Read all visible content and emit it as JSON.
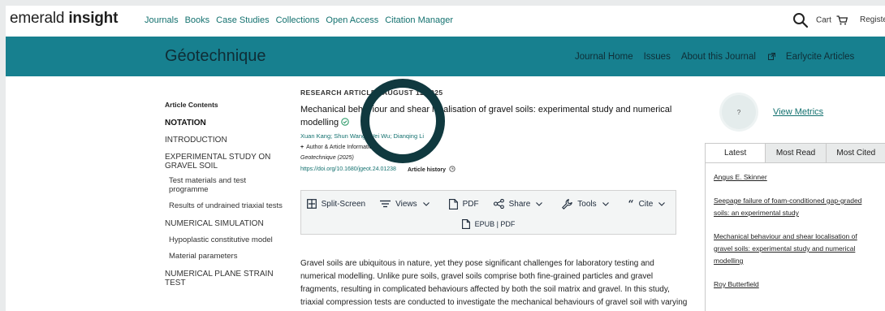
{
  "brand": {
    "logo_light": "emerald",
    "logo_bold": "insight"
  },
  "topnav": [
    "Journals",
    "Books",
    "Case Studies",
    "Collections",
    "Open Access",
    "Citation Manager"
  ],
  "header_right": {
    "cart": "Cart",
    "register": "Registe"
  },
  "journal": {
    "title": "Géotechnique",
    "links": [
      "Journal Home",
      "Issues",
      "About this Journal",
      "Earlycite Articles"
    ]
  },
  "toc": {
    "heading": "Article Contents",
    "items": [
      {
        "label": "NOTATION",
        "level": 1,
        "active": true
      },
      {
        "label": "INTRODUCTION",
        "level": 1
      },
      {
        "label": "EXPERIMENTAL STUDY ON GRAVEL SOIL",
        "level": 1
      },
      {
        "label": "Test materials and test programme",
        "level": 2
      },
      {
        "label": "Results of undrained triaxial tests",
        "level": 2
      },
      {
        "label": "NUMERICAL SIMULATION",
        "level": 1
      },
      {
        "label": "Hypoplastic constitutive model",
        "level": 2
      },
      {
        "label": "Material parameters",
        "level": 2
      },
      {
        "label": "NUMERICAL PLANE STRAIN TEST",
        "level": 1
      }
    ]
  },
  "article": {
    "type_date": "RESEARCH ARTICLE |  AUGUST 12 2025",
    "title": "Mechanical behaviour and shear localisation of gravel soils: experimental study and numerical modelling",
    "authors": "Xuan Kang; Shun Wang; Wei Wu; Dianqing Li",
    "author_info": "Author & Article Information",
    "publication": "Geotechnique (2025)",
    "doi": "https://doi.org/10.1680/jgeot.24.01238",
    "history": "Article history"
  },
  "toolbar": {
    "buttons": [
      {
        "label": "Split-Screen",
        "icon": "split-screen-icon",
        "dropdown": false
      },
      {
        "label": "Views",
        "icon": "views-icon",
        "dropdown": true
      },
      {
        "label": "PDF",
        "icon": "pdf-icon",
        "dropdown": false
      },
      {
        "label": "Share",
        "icon": "share-icon",
        "dropdown": true
      },
      {
        "label": "Tools",
        "icon": "tools-icon",
        "dropdown": true
      },
      {
        "label": "Cite",
        "icon": "cite-icon",
        "dropdown": true
      }
    ],
    "epub": "EPUB | PDF"
  },
  "abstract": "Gravel soils are ubiquitous in nature, yet they pose significant challenges for laboratory testing and numerical modelling. Unlike pure soils, gravel soils comprise both fine-grained particles and gravel fragments, resulting in complicated behaviours affected by both the soil matrix and gravel. In this study, triaxial compression tests are conducted to investigate the mechanical behaviours of gravel soil with varying gravel shapes and contents. The failure mechanisms of",
  "metrics": {
    "badge": "?",
    "link": "View Metrics"
  },
  "tabs": {
    "labels": [
      "Latest",
      "Most Read",
      "Most Cited"
    ],
    "links": [
      "Angus E. Skinner",
      "Seepage failure of foam-conditioned gap-graded soils: an experimental study",
      "Mechanical behaviour and shear localisation of gravel soils: experimental study and numerical modelling",
      "Roy Butterfield"
    ]
  },
  "colors": {
    "accent": "#13716f",
    "journal_bar": "#17808f",
    "ring": "#10393f"
  }
}
